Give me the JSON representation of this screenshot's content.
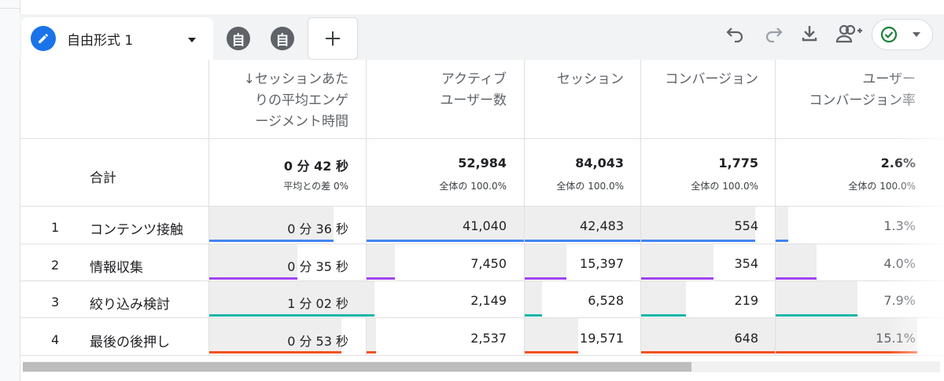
{
  "tabs": {
    "active_title": "自由形式 1",
    "small": [
      "自",
      "自"
    ],
    "add_label": "+"
  },
  "toolbar": {
    "icons": [
      "undo-icon",
      "redo-icon",
      "download-icon",
      "share-user-icon",
      "status-check-icon"
    ]
  },
  "table": {
    "headers": [
      {
        "lines": [
          "↓セッションあた",
          "りの平均エンゲ",
          "ージメント時間"
        ]
      },
      {
        "lines": [
          "アクティブ",
          "ユーザー数"
        ]
      },
      {
        "lines": [
          "セッション"
        ]
      },
      {
        "lines": [
          "コンバージョン"
        ]
      },
      {
        "lines": [
          "ユーザー",
          "コンバージョン率"
        ]
      }
    ],
    "totals": {
      "label": "合計",
      "values": [
        "0 分 42 秒",
        "52,984",
        "84,043",
        "1,775",
        "2.6%"
      ],
      "subs": [
        "平均との差 0%",
        "全体の 100.0%",
        "全体の 100.0%",
        "全体の 100.0%",
        "全体の 100.0%"
      ]
    },
    "rows": [
      {
        "num": "1",
        "name": "コンテンツ接触",
        "values": [
          "0 分 36 秒",
          "41,040",
          "42,483",
          "554",
          "1.3%"
        ],
        "color": "#4285f4"
      },
      {
        "num": "2",
        "name": "情報収集",
        "values": [
          "0 分 35 秒",
          "7,450",
          "15,397",
          "354",
          "4.0%"
        ],
        "color": "#a142f4"
      },
      {
        "num": "3",
        "name": "絞り込み検討",
        "values": [
          "1 分 02 秒",
          "2,149",
          "6,528",
          "219",
          "7.9%"
        ],
        "color": "#12b5a8"
      },
      {
        "num": "4",
        "name": "最後の後押し",
        "values": [
          "0 分 53 秒",
          "2,537",
          "19,571",
          "648",
          "15.1%"
        ],
        "color": "#f4511e"
      }
    ]
  },
  "colors": {
    "accent": "#1a73e8",
    "row1": "#4285f4",
    "row2": "#a142f4",
    "row3": "#12b5a8",
    "row4": "#f4511e",
    "status_ok": "#188038"
  }
}
